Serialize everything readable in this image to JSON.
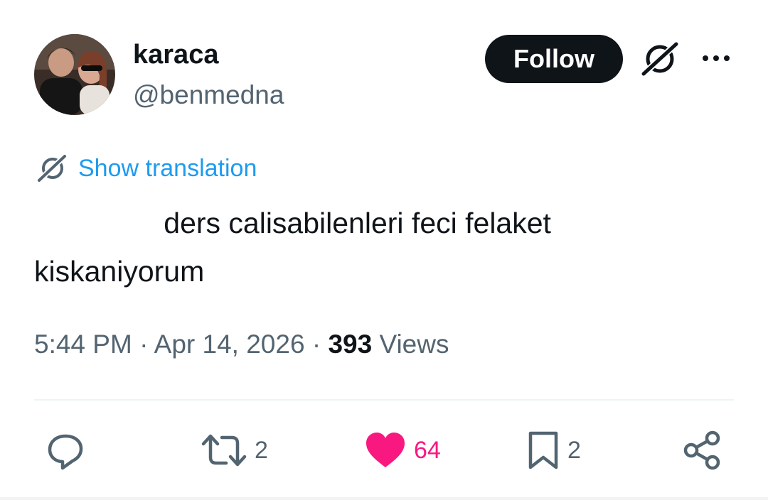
{
  "user": {
    "display_name": "karaca",
    "handle": "@benmedna",
    "follow_label": "Follow"
  },
  "icons": {
    "avatar": "user-avatar-photo",
    "grok": "grok-icon",
    "more": "more-options-icon",
    "translate": "translate-icon",
    "reply": "reply-icon",
    "retweet": "retweet-icon",
    "like": "heart-icon",
    "bookmark": "bookmark-icon",
    "share": "share-icon"
  },
  "tweet": {
    "translate_label": "Show translation",
    "text": "                ders calisabilenleri feci felaket\nkiskaniyorum",
    "time": "5:44 PM",
    "separator": "·",
    "date": "Apr 14, 2026",
    "views_count": "393",
    "views_label": "Views"
  },
  "actions": {
    "retweet_count": "2",
    "like_count": "64",
    "bookmark_count": "2"
  },
  "colors": {
    "text": "#0f1419",
    "secondary": "#536471",
    "link": "#1d9bf0",
    "like": "#f91880",
    "follow_bg": "#0f1419"
  }
}
